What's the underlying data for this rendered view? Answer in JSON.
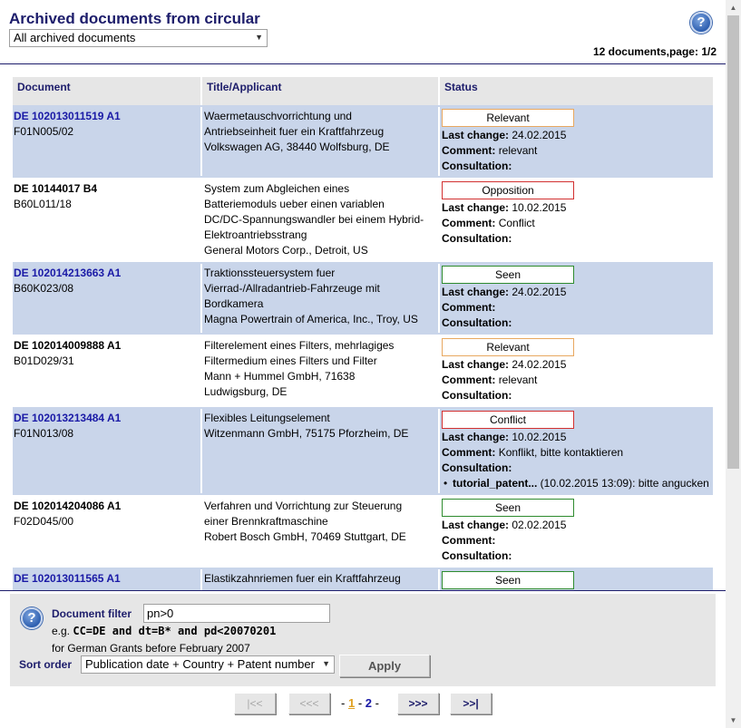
{
  "header": {
    "title": "Archived documents from circular",
    "filter_select": "All archived documents",
    "doc_count": "12 documents,page: 1/2",
    "help_icon": "question-mark-icon"
  },
  "table": {
    "columns": [
      "Document",
      "Title/Applicant",
      "Status"
    ],
    "labels": {
      "last_change": "Last change:",
      "comment": "Comment:",
      "consultation": "Consultation:"
    },
    "rows": [
      {
        "doc": "DE 102013011519 A1",
        "link": true,
        "ipc": "F01N005/02",
        "title": [
          "Waermetauschvorrichtung und",
          "Antriebseinheit fuer ein Kraftfahrzeug",
          "Volkswagen AG, 38440 Wolfsburg, DE"
        ],
        "status": "Relevant",
        "status_color": "#e8a860",
        "last_change": "24.02.2015",
        "comment": "relevant",
        "consultation": []
      },
      {
        "doc": "DE 10144017 B4",
        "link": false,
        "ipc": "B60L011/18",
        "title": [
          "System zum Abgleichen eines",
          "Batteriemoduls ueber einen variablen",
          "DC/DC-Spannungswandler bei einem Hybrid-",
          "Elektroantriebsstrang",
          "General Motors Corp., Detroit, US"
        ],
        "status": "Opposition",
        "status_color": "#d23030",
        "last_change": "10.02.2015",
        "comment": "Conflict",
        "consultation": []
      },
      {
        "doc": "DE 102014213663 A1",
        "link": true,
        "ipc": "B60K023/08",
        "title": [
          "Traktionssteuersystem fuer",
          "Vierrad-/Allradantrieb-Fahrzeuge mit",
          "Bordkamera",
          "Magna Powertrain of America, Inc., Troy, US"
        ],
        "status": "Seen",
        "status_color": "#2e8b2e",
        "last_change": "24.02.2015",
        "comment": "",
        "consultation": []
      },
      {
        "doc": "DE 102014009888 A1",
        "link": false,
        "ipc": "B01D029/31",
        "title": [
          "Filterelement eines Filters, mehrlagiges",
          "Filtermedium eines Filters und Filter",
          "Mann + Hummel GmbH, 71638",
          "Ludwigsburg, DE"
        ],
        "status": "Relevant",
        "status_color": "#e8a860",
        "last_change": "24.02.2015",
        "comment": "relevant",
        "consultation": []
      },
      {
        "doc": "DE 102013213484 A1",
        "link": true,
        "ipc": "F01N013/08",
        "title": [
          "Flexibles Leitungselement",
          "Witzenmann GmbH, 75175 Pforzheim, DE"
        ],
        "status": "Conflict",
        "status_color": "#d23030",
        "last_change": "10.02.2015",
        "comment": "Konflikt, bitte kontaktieren",
        "consultation": [
          {
            "user": "tutorial_patent...",
            "text": " (10.02.2015 13:09): bitte angucken"
          }
        ]
      },
      {
        "doc": "DE 102014204086 A1",
        "link": false,
        "ipc": "F02D045/00",
        "title": [
          "Verfahren und Vorrichtung zur Steuerung",
          "einer Brennkraftmaschine",
          "Robert Bosch GmbH, 70469 Stuttgart, DE"
        ],
        "status": "Seen",
        "status_color": "#2e8b2e",
        "last_change": "02.02.2015",
        "comment": "",
        "consultation": []
      },
      {
        "doc": "DE 102013011565 A1",
        "link": true,
        "ipc": "",
        "title": [
          "Elastikzahnriemen fuer ein Kraftfahrzeug"
        ],
        "status": "Seen",
        "status_color": "#2e8b2e",
        "last_change": "",
        "comment": "",
        "consultation": []
      }
    ]
  },
  "filter_panel": {
    "help_icon": "question-mark-icon",
    "label": "Document filter",
    "input_value": "pn>0",
    "example_prefix": "e.g. ",
    "example_code": "CC=DE and dt=B* and pd<20070201",
    "hint": "for German Grants before February 2007",
    "sort_label": "Sort order",
    "sort_value": "Publication date + Country + Patent number",
    "apply": "Apply"
  },
  "pager": {
    "first": "|<<",
    "prev": "<<<",
    "next": ">>>",
    "last": ">>|",
    "dash": "-",
    "pages": [
      "1",
      "2"
    ],
    "current": "1"
  }
}
